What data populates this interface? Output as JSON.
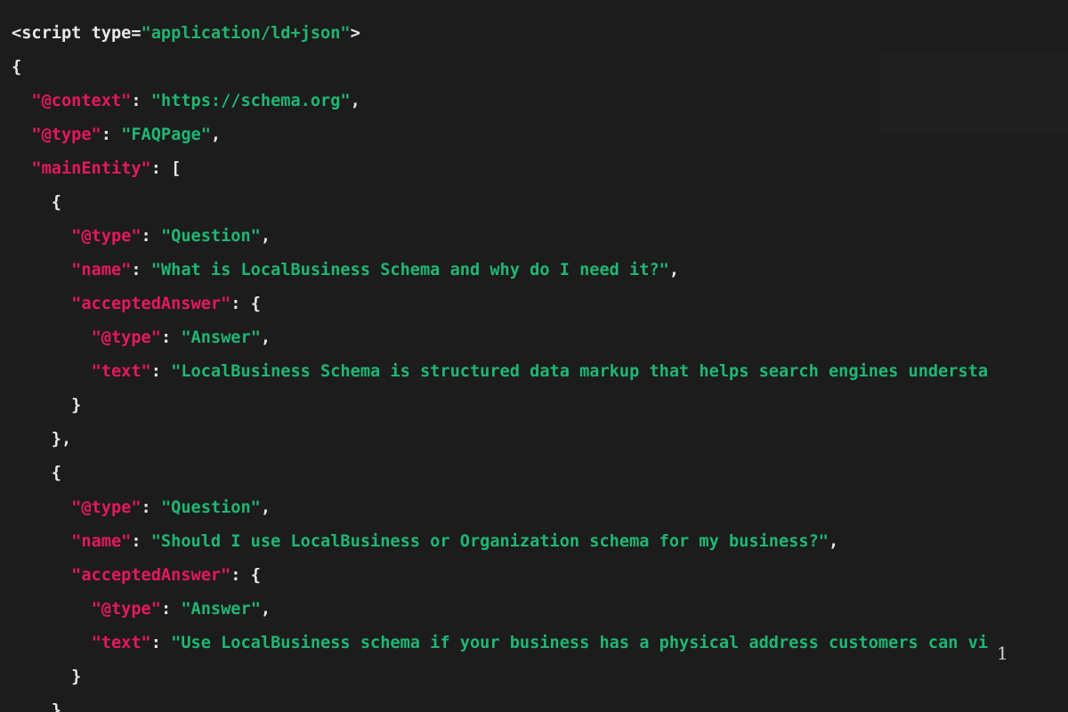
{
  "code": {
    "line1": {
      "tag_open": "<script",
      "attr": " type=",
      "attr_value": "\"application/ld+json\"",
      "tag_close": ">"
    },
    "line2": {
      "brace": "{"
    },
    "line3": {
      "key": "\"@context\"",
      "sep": ": ",
      "value": "\"https://schema.org\"",
      "end": ","
    },
    "line4": {
      "key": "\"@type\"",
      "sep": ": ",
      "value": "\"FAQPage\"",
      "end": ","
    },
    "line5": {
      "key": "\"mainEntity\"",
      "sep": ": ",
      "bracket": "["
    },
    "line6": {
      "brace": "{"
    },
    "line7": {
      "key": "\"@type\"",
      "sep": ": ",
      "value": "\"Question\"",
      "end": ","
    },
    "line8": {
      "key": "\"name\"",
      "sep": ": ",
      "value": "\"What is LocalBusiness Schema and why do I need it?\"",
      "end": ","
    },
    "line9": {
      "key": "\"acceptedAnswer\"",
      "sep": ": ",
      "brace": "{"
    },
    "line10": {
      "key": "\"@type\"",
      "sep": ": ",
      "value": "\"Answer\"",
      "end": ","
    },
    "line11": {
      "key": "\"text\"",
      "sep": ": ",
      "value": "\"LocalBusiness Schema is structured data markup that helps search engines understa"
    },
    "line12": {
      "brace": "}"
    },
    "line13": {
      "brace": "},"
    },
    "line14": {
      "brace": "{"
    },
    "line15": {
      "key": "\"@type\"",
      "sep": ": ",
      "value": "\"Question\"",
      "end": ","
    },
    "line16": {
      "key": "\"name\"",
      "sep": ": ",
      "value": "\"Should I use LocalBusiness or Organization schema for my business?\"",
      "end": ","
    },
    "line17": {
      "key": "\"acceptedAnswer\"",
      "sep": ": ",
      "brace": "{"
    },
    "line18": {
      "key": "\"@type\"",
      "sep": ": ",
      "value": "\"Answer\"",
      "end": ","
    },
    "line19": {
      "key": "\"text\"",
      "sep": ": ",
      "value": "\"Use LocalBusiness schema if your business has a physical address customers can vi"
    },
    "line20": {
      "brace": "}"
    },
    "line21": {
      "brace": "},"
    }
  },
  "overlay_digit": "1",
  "colors": {
    "background": "#1c1c1c",
    "key": "#e5195e",
    "string": "#1fb774",
    "punctuation": "#e8e8e8"
  }
}
